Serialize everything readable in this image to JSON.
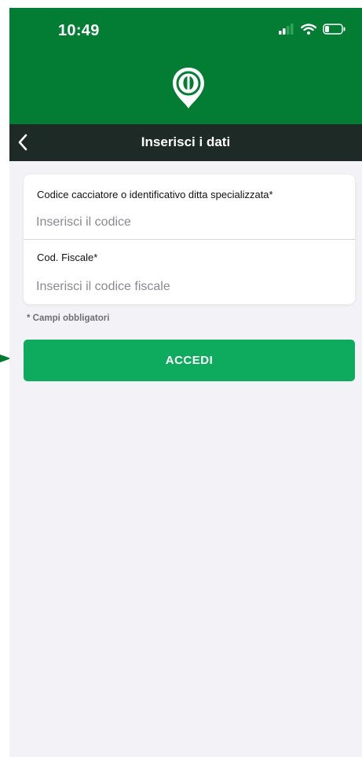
{
  "status_bar": {
    "time": "10:49",
    "icons": [
      "signal-icon",
      "wifi-icon",
      "battery-icon"
    ]
  },
  "header": {
    "logo_icon": "hoofprint-pin-icon",
    "background_color": "#037d34"
  },
  "navbar": {
    "back_icon": "chevron-left-icon",
    "title": "Inserisci i dati",
    "background_color": "#1d2a26"
  },
  "form": {
    "hunter_code": {
      "label": "Codice cacciatore o identificativo ditta specializzata*",
      "value": "",
      "placeholder": "Inserisci il codice"
    },
    "fiscal_code": {
      "label": "Cod. Fiscale*",
      "value": "",
      "placeholder": "Inserisci il codice fiscale"
    },
    "required_note": "* Campi obbligatori"
  },
  "login_button": {
    "label": "ACCEDI",
    "color": "#0eaa5d"
  }
}
